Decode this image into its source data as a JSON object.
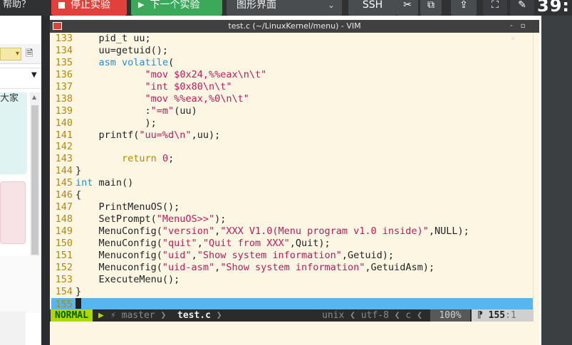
{
  "toolbar": {
    "help": "帮助？",
    "stop_label": "停止实验",
    "next_label": "下一个实验",
    "gui_select": "图形界面",
    "ssh_label": "SSH",
    "clock": "39:"
  },
  "left_page": {
    "partial_text": "大家"
  },
  "vim": {
    "window_title": "test.c (~/LinuxKernel/menu) - VIM",
    "window_controls": "- ▫ ×",
    "lines": [
      {
        "n": "133",
        "t": "    pid_t uu;"
      },
      {
        "n": "134",
        "t": "    uu=getuid();"
      },
      {
        "n": "135",
        "t": "    asm volatile("
      },
      {
        "n": "136",
        "t": "            \"mov $0x24,%%eax\\n\\t\""
      },
      {
        "n": "137",
        "t": "            \"int $0x80\\n\\t\""
      },
      {
        "n": "138",
        "t": "            \"mov %%eax,%0\\n\\t\""
      },
      {
        "n": "139",
        "t": "            :\"=m\"(uu)"
      },
      {
        "n": "140",
        "t": "            );"
      },
      {
        "n": "141",
        "t": "    printf(\"uu=%d\\n\",uu);"
      },
      {
        "n": "142",
        "t": ""
      },
      {
        "n": "143",
        "t": "        return 0;"
      },
      {
        "n": "144",
        "t": "}"
      },
      {
        "n": "145",
        "t": "int main()"
      },
      {
        "n": "146",
        "t": "{"
      },
      {
        "n": "147",
        "t": "    PrintMenuOS();"
      },
      {
        "n": "148",
        "t": "    SetPrompt(\"MenuOS>>\");"
      },
      {
        "n": "149",
        "t": "    MenuConfig(\"version\",\"XXX V1.0(Menu program v1.0 inside)\",NULL);"
      },
      {
        "n": "150",
        "t": "    MenuConfig(\"quit\",\"Quit from XXX\",Quit);"
      },
      {
        "n": "151",
        "t": "    Menuconfig(\"uid\",\"Show system information\",Getuid);"
      },
      {
        "n": "152",
        "t": "    Menuconfig(\"uid-asm\",\"Show system information\",GetuidAsm);"
      },
      {
        "n": "153",
        "t": "    ExecuteMenu();"
      },
      {
        "n": "154",
        "t": "}"
      },
      {
        "n": "155",
        "t": ""
      }
    ],
    "status": {
      "mode": "NORMAL",
      "branch": "⚡ master",
      "separator": "❯",
      "file": "test.c",
      "fileformat": "unix",
      "encoding": "utf-8",
      "filetype": "c",
      "percent": "100%",
      "line_col_prefix": "⁋",
      "line": "155",
      "col": ":1"
    }
  },
  "colors": {
    "keyword": "#268bd2",
    "string": "#c2185b",
    "line_number": "#b58900",
    "background": "#fdf6e3",
    "mode": "#afd700"
  }
}
